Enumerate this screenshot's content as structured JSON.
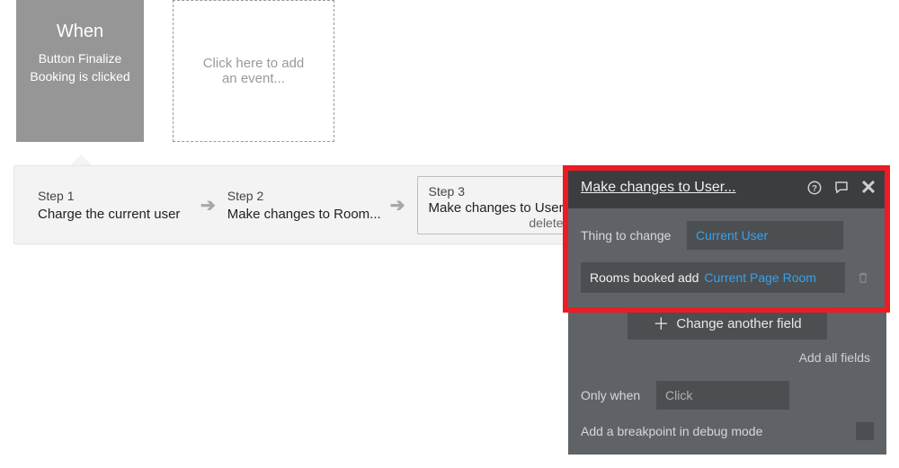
{
  "event": {
    "title": "When",
    "subtitle": "Button Finalize Booking is clicked"
  },
  "add_event_placeholder": "Click here to add an event...",
  "steps": {
    "s1": {
      "num": "Step 1",
      "label": "Charge the current user"
    },
    "s2": {
      "num": "Step 2",
      "label": "Make changes to Room..."
    },
    "s3": {
      "num": "Step 3",
      "label": "Make changes to User...",
      "delete": "delete"
    }
  },
  "editor": {
    "title": "Make changes to User...",
    "thing_to_change_label": "Thing to change",
    "thing_to_change_value": "Current User",
    "rooms_booked_label": "Rooms booked add",
    "rooms_booked_value": "Current Page Room",
    "change_another_label": "Change another field",
    "add_all_label": "Add all fields",
    "only_when_label": "Only when",
    "only_when_placeholder": "Click",
    "breakpoint_label": "Add a breakpoint in debug mode"
  }
}
